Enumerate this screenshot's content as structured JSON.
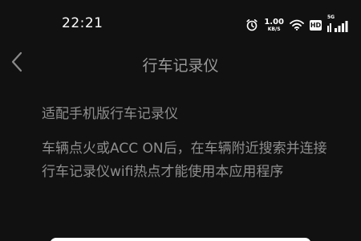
{
  "status_bar": {
    "time": "22:21",
    "net_speed_value": "1.00",
    "net_speed_unit": "KB/S",
    "hd_badge": "HD",
    "network_type": "5G",
    "icons": [
      "alarm-icon",
      "wifi-icon",
      "hd-badge",
      "signal-icon"
    ]
  },
  "nav": {
    "back_icon": "chevron-left-icon",
    "title": "行车记录仪"
  },
  "content": {
    "subtitle": "适配手机版行车记录仪",
    "description_line1": "车辆点火或ACC ON后，在车辆附近搜索并连接",
    "description_line2": "行车记录仪wifi热点才能使用本应用程序"
  },
  "colors": {
    "background": "#111111",
    "title": "#9a9a9a",
    "text": "#8e8e8e",
    "status_text": "#ffffff"
  }
}
